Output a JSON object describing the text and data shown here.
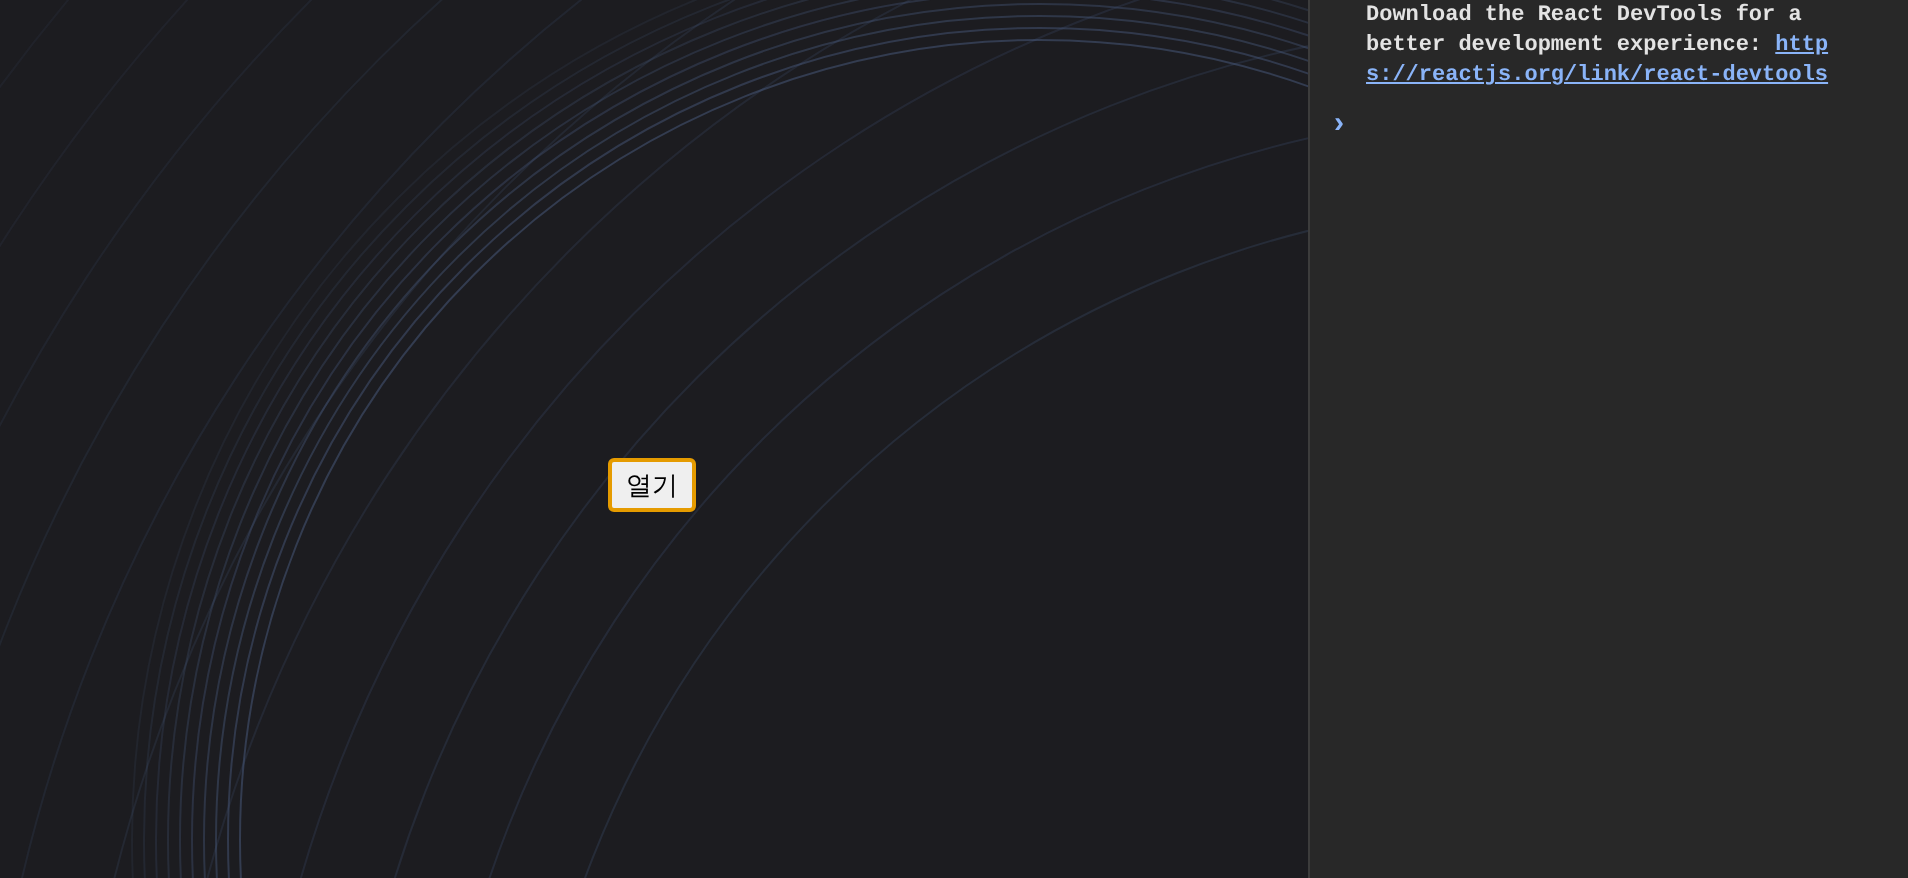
{
  "page": {
    "button": {
      "label": "열기",
      "focused": true
    }
  },
  "console": {
    "messages": [
      {
        "text": "Download the React DevTools for a better development experience: ",
        "link_lines": [
          "http",
          "s://reactjs.org/link/react-devtools"
        ]
      }
    ],
    "prompt": "›"
  }
}
